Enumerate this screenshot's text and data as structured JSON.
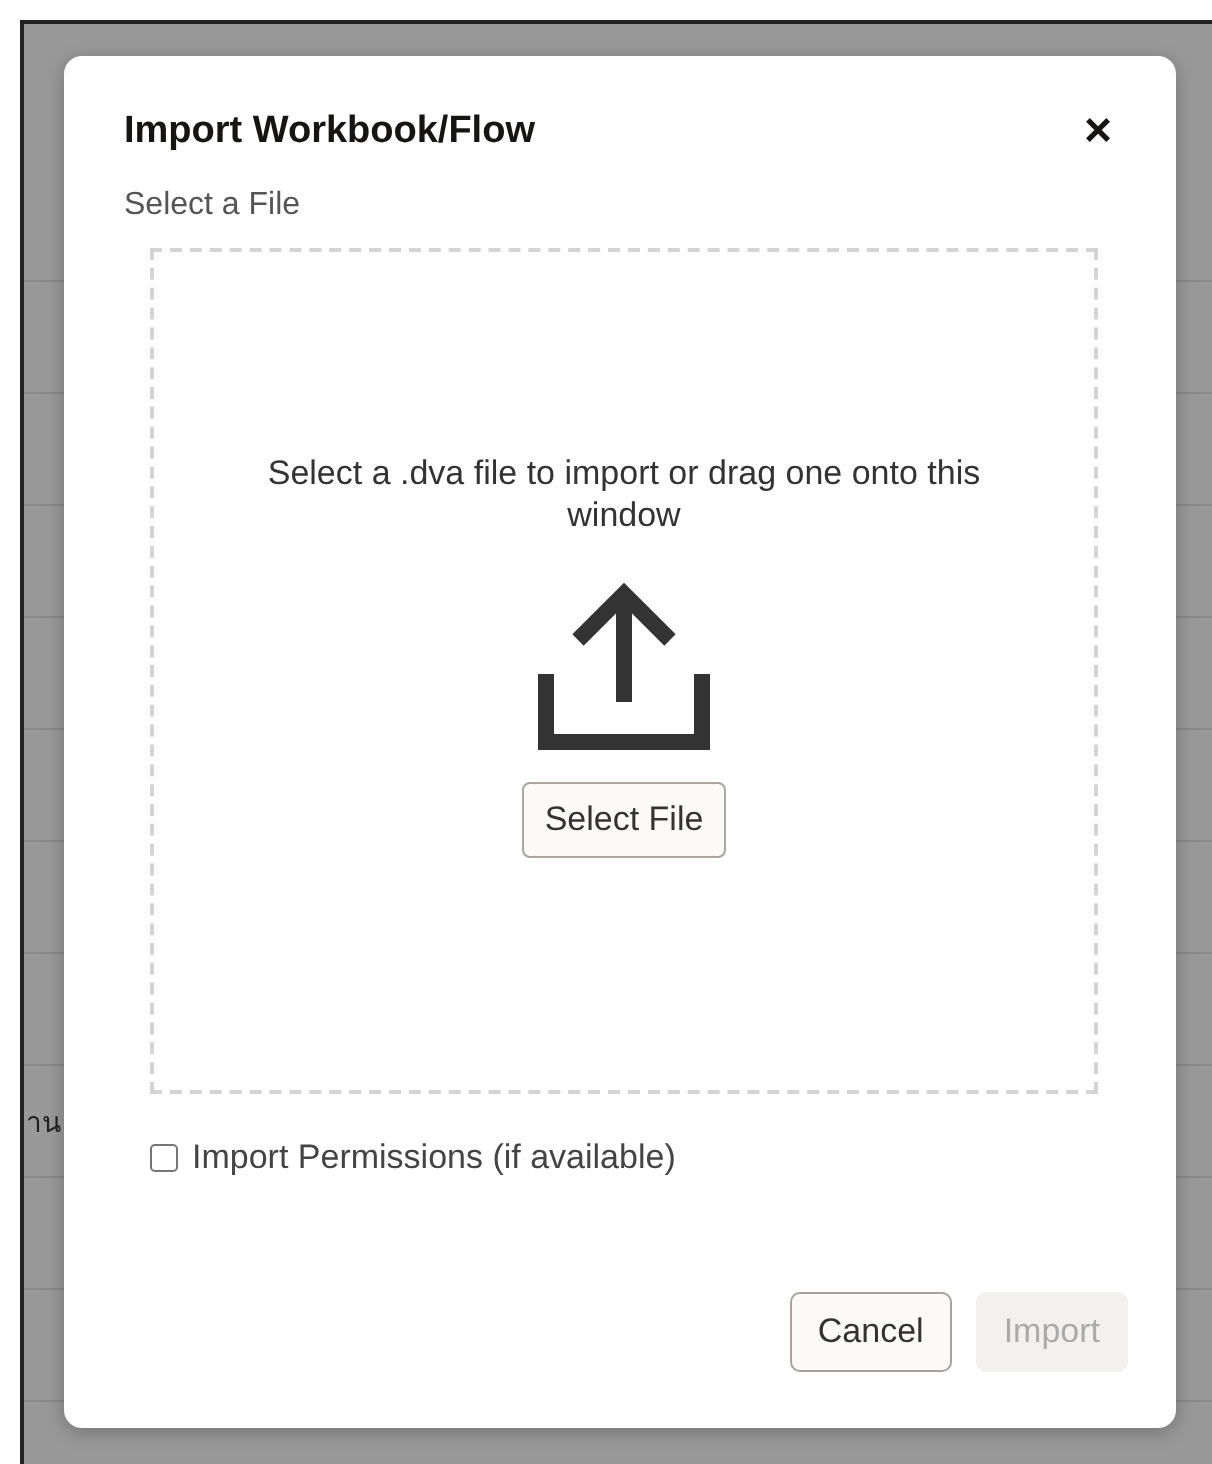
{
  "background": {
    "row_text": "าน"
  },
  "dialog": {
    "title": "Import Workbook/Flow",
    "close": "×",
    "section_label": "Select a File",
    "dropzone": {
      "instructions": "Select a .dva file to import or drag one onto this window",
      "button": "Select File"
    },
    "option": {
      "label": "Import Permissions (if available)",
      "checked": false
    },
    "buttons": [
      {
        "label": "Cancel",
        "disabled": false
      },
      {
        "label": "Import",
        "disabled": true
      }
    ]
  }
}
